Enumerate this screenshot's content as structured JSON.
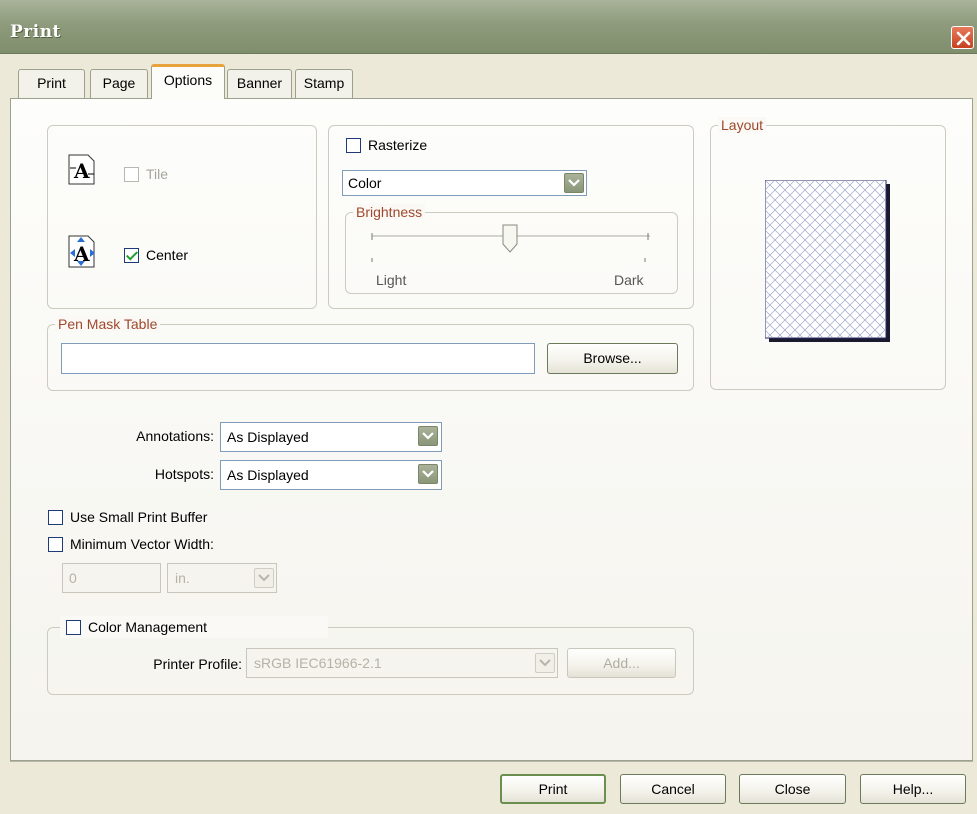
{
  "window": {
    "title": "Print"
  },
  "tabs": [
    {
      "label": "Print",
      "active": false
    },
    {
      "label": "Page",
      "active": false
    },
    {
      "label": "Options",
      "active": true
    },
    {
      "label": "Banner",
      "active": false
    },
    {
      "label": "Stamp",
      "active": false
    }
  ],
  "placement": {
    "tile_label": "Tile",
    "tile_checked": false,
    "tile_enabled": false,
    "center_label": "Center",
    "center_checked": true
  },
  "raster": {
    "rasterize_label": "Rasterize",
    "rasterize_checked": false,
    "color_mode": "Color",
    "brightness_legend": "Brightness",
    "brightness_min_label": "Light",
    "brightness_max_label": "Dark",
    "brightness_level": 0.5
  },
  "layout": {
    "legend": "Layout"
  },
  "pen_mask": {
    "legend": "Pen Mask Table",
    "value": "",
    "browse_label": "Browse..."
  },
  "annotations": {
    "label": "Annotations:",
    "value": "As Displayed"
  },
  "hotspots": {
    "label": "Hotspots:",
    "value": "As Displayed"
  },
  "small_buffer": {
    "label": "Use Small Print Buffer",
    "checked": false
  },
  "min_vector": {
    "label": "Minimum Vector Width:",
    "checked": false,
    "value": "0",
    "unit": "in."
  },
  "color_mgmt": {
    "label": "Color Management",
    "checked": false,
    "profile_label": "Printer Profile:",
    "profile_value": "sRGB IEC61966-2.1",
    "add_label": "Add..."
  },
  "buttons": {
    "print": "Print",
    "cancel": "Cancel",
    "close": "Close",
    "help": "Help..."
  },
  "colors": {
    "titlebar": "#8e9b7c",
    "accent": "#e8a33c",
    "legend_text": "#a0482d",
    "check": "#1f9e2e"
  }
}
